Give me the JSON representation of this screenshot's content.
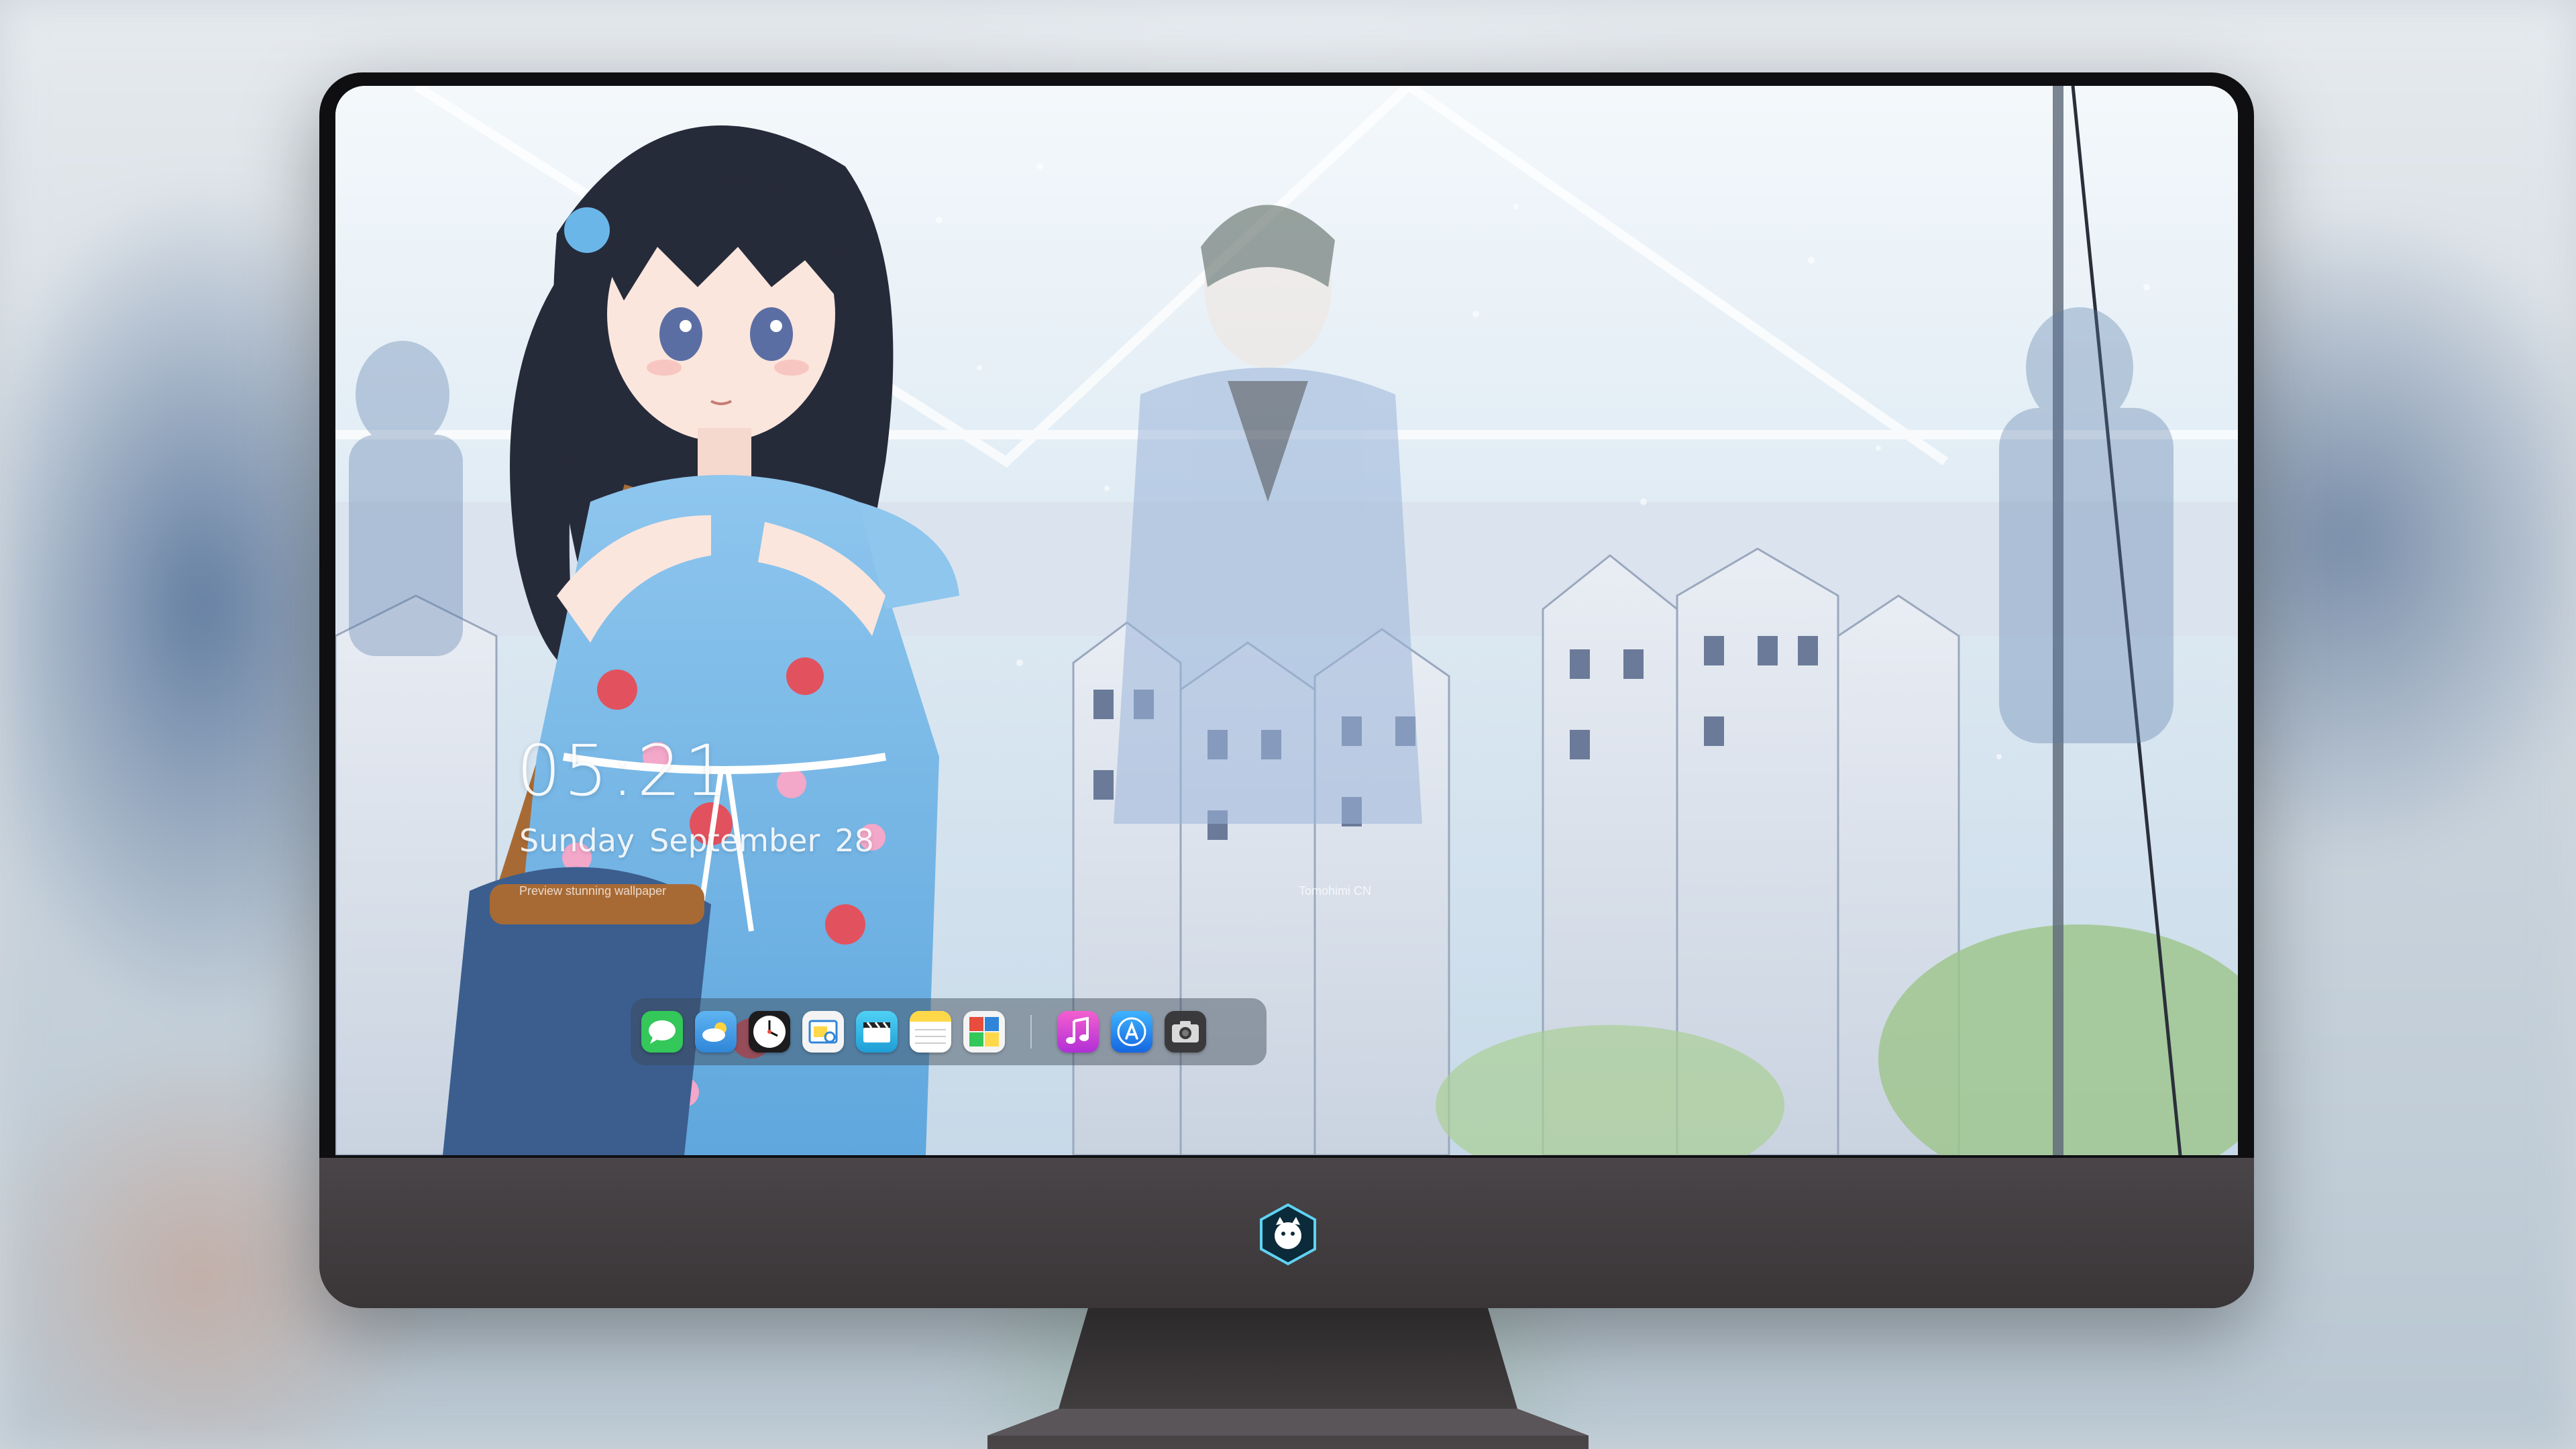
{
  "lock_screen": {
    "time": "05:21",
    "weekday": "Sunday",
    "month": "September",
    "day": "28",
    "credit_left": "Preview stunning wallpaper",
    "credit_right": "Tomohimi CN"
  },
  "dock": {
    "apps": [
      {
        "name": "messages-icon",
        "color": "#34c759"
      },
      {
        "name": "weather-icon",
        "color": "#3a9be8"
      },
      {
        "name": "clock-icon",
        "color": "#1c1c1e"
      },
      {
        "name": "preview-icon",
        "color": "#f4f4f4"
      },
      {
        "name": "clips-icon",
        "color": "#2ab7e6"
      },
      {
        "name": "notes-icon",
        "color": "#ffd84a"
      },
      {
        "name": "photo-booth-icon",
        "color": "#e74c3c"
      },
      {
        "name": "itunes-icon",
        "color": "#d63bd8"
      },
      {
        "name": "app-store-icon",
        "color": "#1e8cf0"
      },
      {
        "name": "screenshot-icon",
        "color": "#3a3a3c"
      }
    ]
  },
  "colors": {
    "bezel": "#0f0f12",
    "chin": "#433e41",
    "stand": "#3b3739"
  }
}
